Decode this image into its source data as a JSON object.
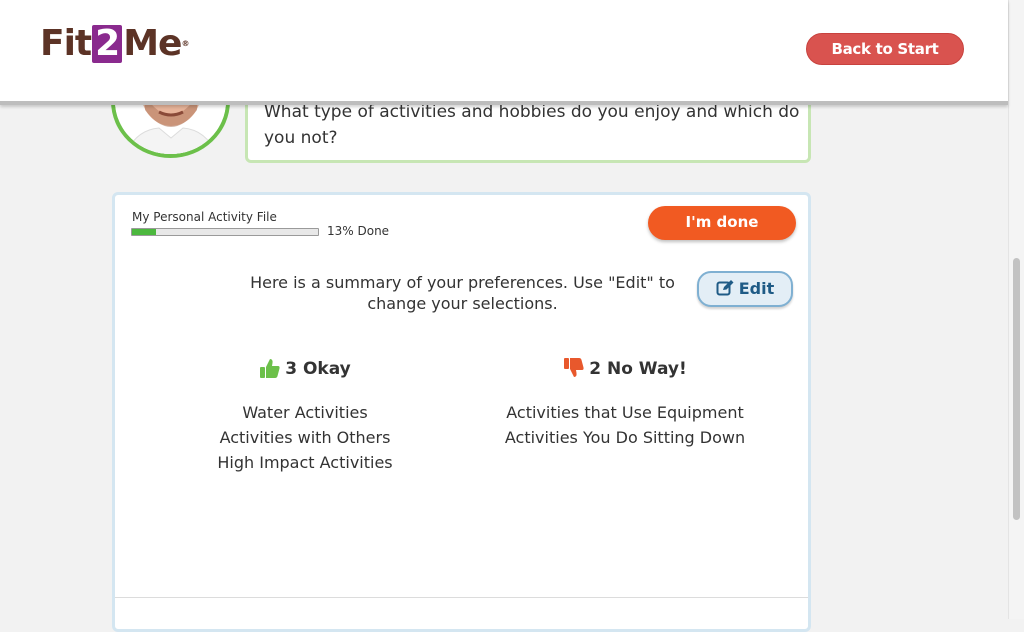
{
  "header": {
    "logo": {
      "part1": "Fit",
      "part2": "2",
      "part3": "Me",
      "trademark": "®"
    },
    "back_button": "Back to Start"
  },
  "question": {
    "text": "What type of activities and hobbies do you enjoy and which do you not?"
  },
  "activity_file": {
    "label": "My Personal Activity File",
    "progress_percent": 13,
    "progress_label": "13% Done",
    "done_button": "I'm done"
  },
  "summary": {
    "text": "Here is a summary of your preferences. Use \"Edit\" to change your selections.",
    "edit_button": "Edit"
  },
  "okay": {
    "title": "3 Okay",
    "icon": "thumbs-up-icon",
    "color": "#6cc04a",
    "items": [
      "Water Activities",
      "Activities with Others",
      "High Impact Activities"
    ]
  },
  "no_way": {
    "title": "2 No Way!",
    "icon": "thumbs-down-icon",
    "color": "#e8582c",
    "items": [
      "Activities that Use Equipment",
      "Activities You Do Sitting Down"
    ]
  },
  "colors": {
    "accent_red": "#d9534f",
    "done_orange": "#f15a22",
    "brand_purple": "#8a2a8e",
    "progress_green": "#4cb83e"
  }
}
